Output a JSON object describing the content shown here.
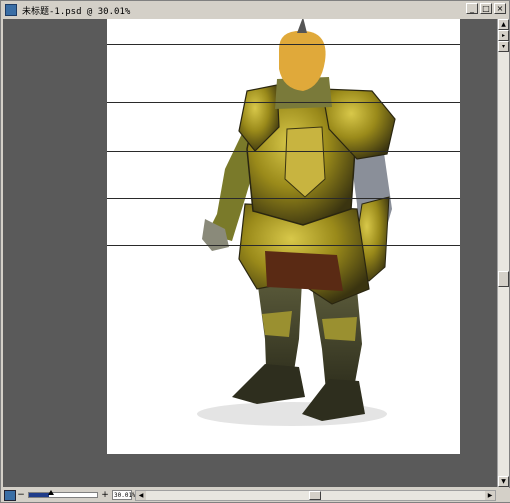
{
  "window": {
    "title": "未标题-1.psd @ 30.01%",
    "buttons": {
      "minimize": "_",
      "maximize": "□",
      "close": "×"
    }
  },
  "document": {
    "background": "#ffffff",
    "pasteboard": "#5a5a5a",
    "guides_count": 5,
    "subject": "armored knight figure painting"
  },
  "status": {
    "zoom_text": "30.01%",
    "zoom_fraction": 0.3001
  },
  "colors": {
    "armor_gold": "#9a8a1a",
    "armor_dark": "#3a3a22",
    "chainmail": "#8a8f99",
    "head": "#e0a93a"
  },
  "icons": {
    "navigator": "navigator-icon",
    "zoom_out": "zoom-out-icon",
    "zoom_in": "zoom-in-icon"
  }
}
